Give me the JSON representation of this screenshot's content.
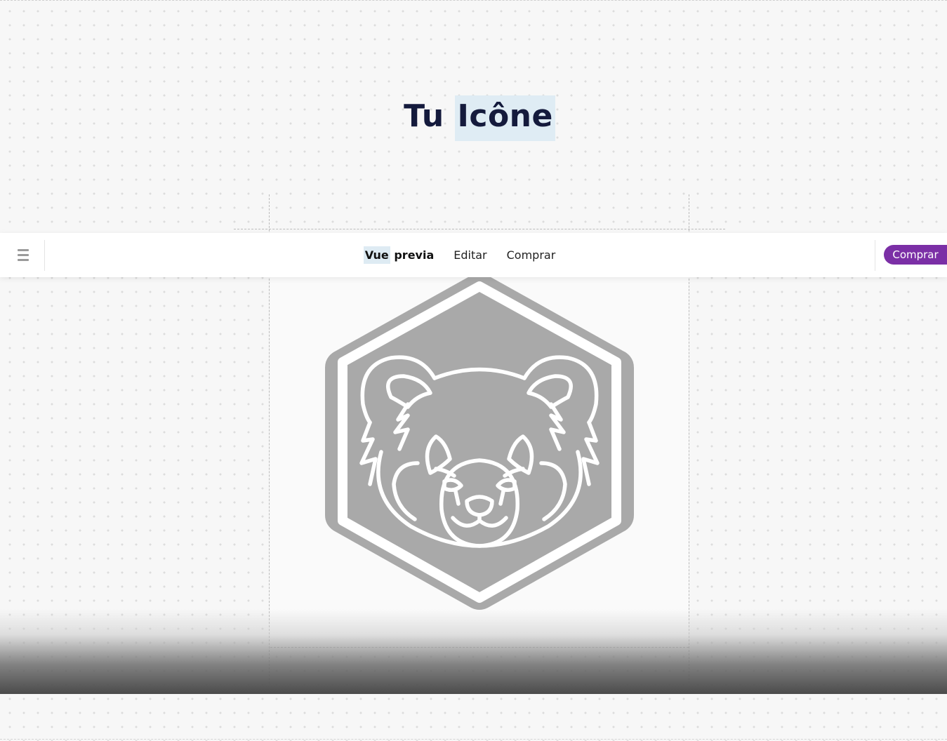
{
  "page": {
    "title_part1": "Tu",
    "title_part2": "Icône"
  },
  "toolbar": {
    "menu_icon": "hamburger-menu-icon",
    "tabs": [
      {
        "label_a": "Vue",
        "label_b": "previa",
        "active": true
      },
      {
        "label": "Editar"
      },
      {
        "label": "Comprar"
      }
    ],
    "buy_button": "Comprar"
  },
  "preview": {
    "icon": "red-panda-hexagon-badge-icon",
    "icon_color": "#a9a9a9",
    "line_color": "#ffffff"
  },
  "colors": {
    "accent": "#7b2fa6",
    "title": "#141a3c",
    "highlight": "#dfecf4"
  }
}
